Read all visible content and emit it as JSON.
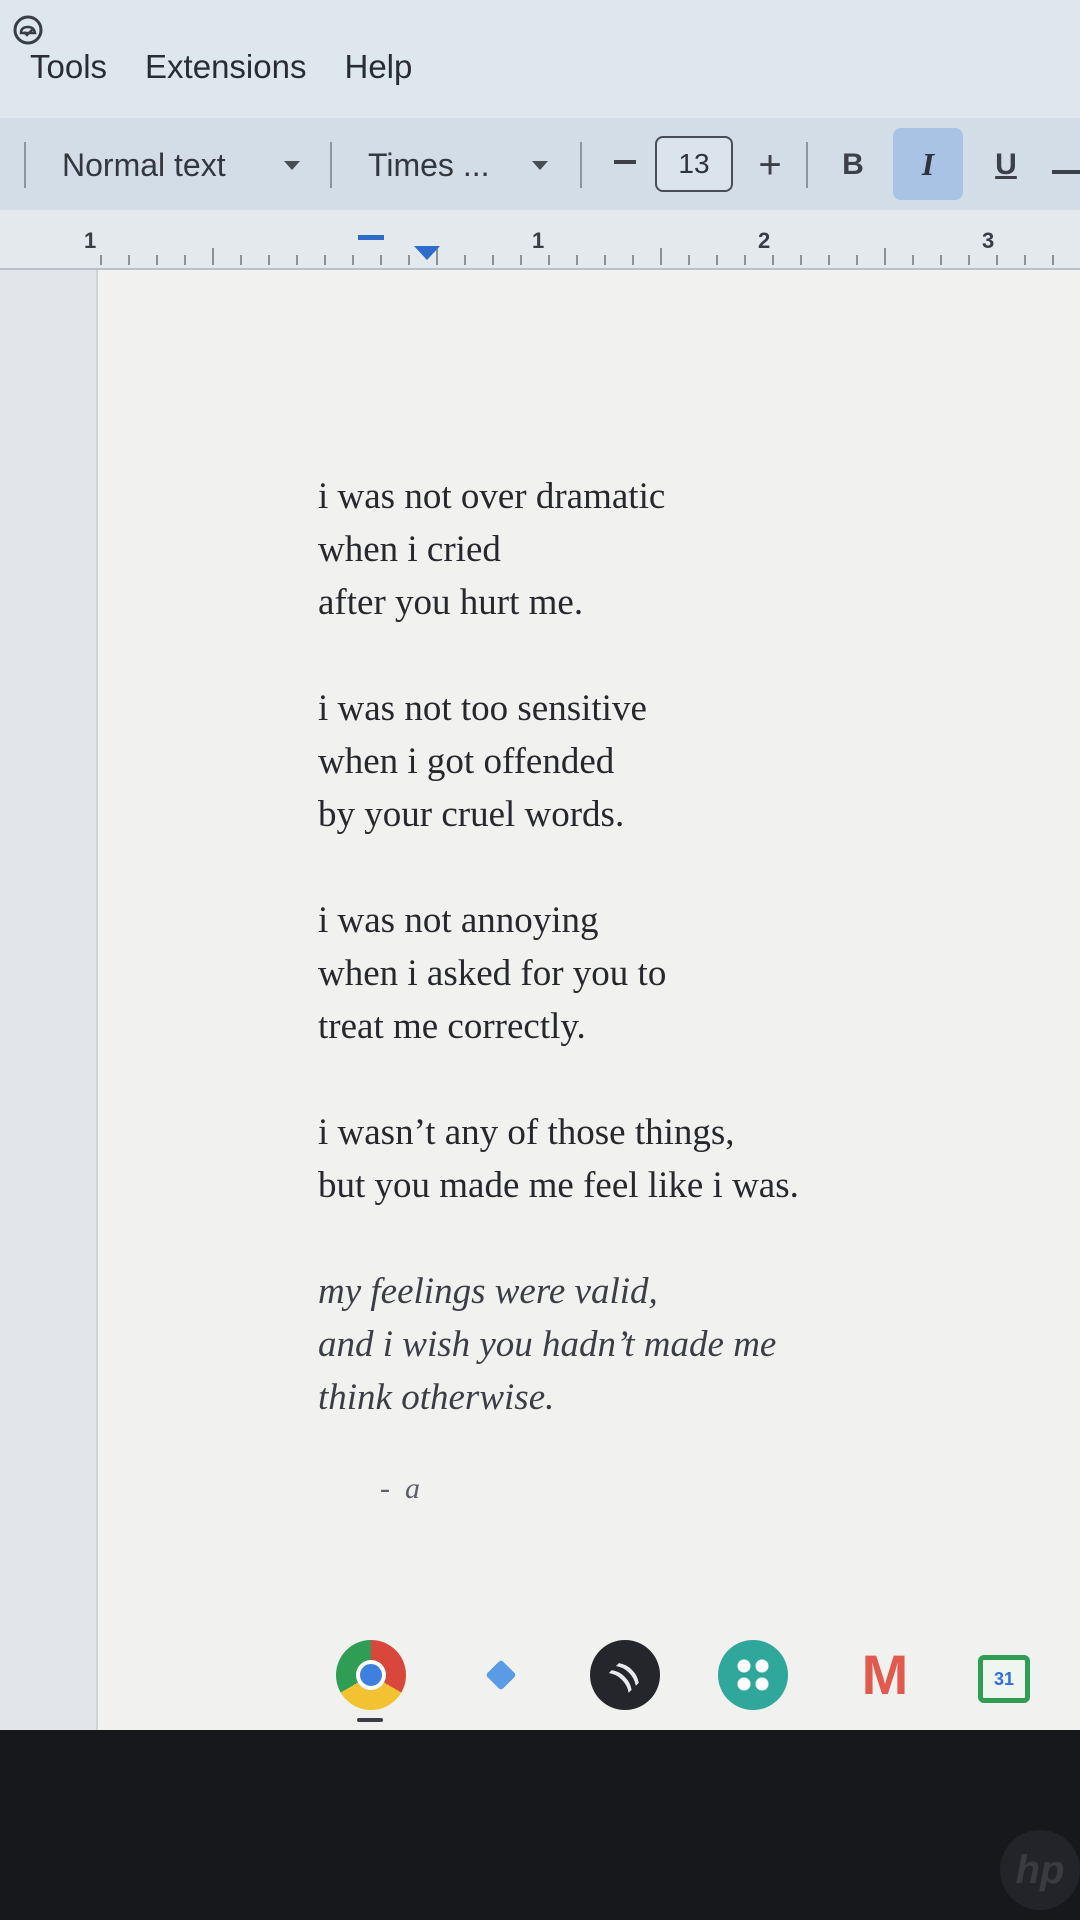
{
  "menu": {
    "tools": "Tools",
    "extensions": "Extensions",
    "help": "Help"
  },
  "toolbar": {
    "paragraph_style": "Normal text",
    "font": "Times ...",
    "font_size": "13",
    "bold": "B",
    "italic": "I",
    "underline": "U",
    "italic_active": true
  },
  "ruler": {
    "labels": [
      "1",
      "1",
      "2",
      "3"
    ]
  },
  "document": {
    "stanzas": [
      [
        "i was not over dramatic",
        "when i cried",
        "after you hurt me."
      ],
      [
        "i was not too sensitive",
        "when i got offended",
        "by your cruel words."
      ],
      [
        "i was not annoying",
        "when i asked for you to",
        "treat me correctly."
      ],
      [
        "i wasn’t any of those things,",
        "but you made me feel like i was."
      ],
      [
        "my feelings were valid,",
        "and i wish you hadn’t made me",
        "think otherwise."
      ]
    ],
    "signature": "-  a"
  },
  "shelf": {
    "apps": [
      "chrome-icon",
      "gemini-icon",
      "podcast-icon",
      "launcher-icon",
      "gmail-icon",
      "calendar-icon"
    ]
  },
  "colors": {
    "toolbar_bg": "#d2dde8",
    "active_button": "#a9c3e4",
    "ruler_marker": "#2d6cc9",
    "page_bg": "#f1f1ef"
  }
}
